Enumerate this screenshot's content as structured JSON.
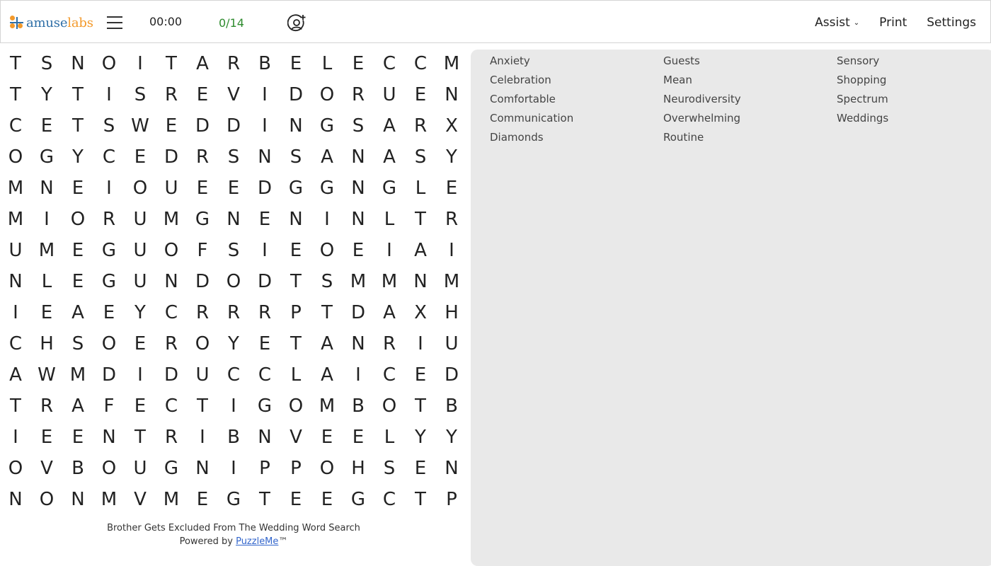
{
  "header": {
    "logo": {
      "part1": "amuse",
      "part2": "labs"
    },
    "timer": "00:00",
    "progress": "0/14",
    "icons": {
      "menu": "hamburger-menu-icon",
      "user": "add-user-icon"
    },
    "nav": {
      "assist": "Assist",
      "assist_chevron": "⌄",
      "print": "Print",
      "settings": "Settings"
    },
    "colors": {
      "progress": "#2e8b2e",
      "logo_blue": "#2f6fa7",
      "logo_orange": "#f39a2c"
    }
  },
  "grid": {
    "rows": [
      "TSNOITARBELECCM",
      "TYTISREVIDORUEN",
      "CETSWEDDINGSARX",
      "OGYCEDRSNSANASY",
      "MNEIOUEEDGGNGLE",
      "MIORUMGNENINLTR",
      "UMEGUOFSIEOEIAI",
      "NLEGUNDODTSMMNM",
      "IEAEYCRRRPTDAXH",
      "CHSOEROYETANRIU",
      "AWMDIDUCCLAICED",
      "TRAFECTIGOMBOTB",
      "IEENTRIBNVEELYY",
      "OVBOUGNIPPOHSEN",
      "NONMVMEGTEEGCTP"
    ]
  },
  "words": {
    "col1": [
      "Anxiety",
      "Celebration",
      "Comfortable",
      "Communication",
      "Diamonds"
    ],
    "col2": [
      "Guests",
      "Mean",
      "Neurodiversity",
      "Overwhelming",
      "Routine"
    ],
    "col3": [
      "Sensory",
      "Shopping",
      "Spectrum",
      "Weddings"
    ]
  },
  "footer": {
    "title": "Brother Gets Excluded From The Wedding Word Search",
    "powered_prefix": "Powered by ",
    "powered_link": "PuzzleMe",
    "trademark": "™"
  }
}
